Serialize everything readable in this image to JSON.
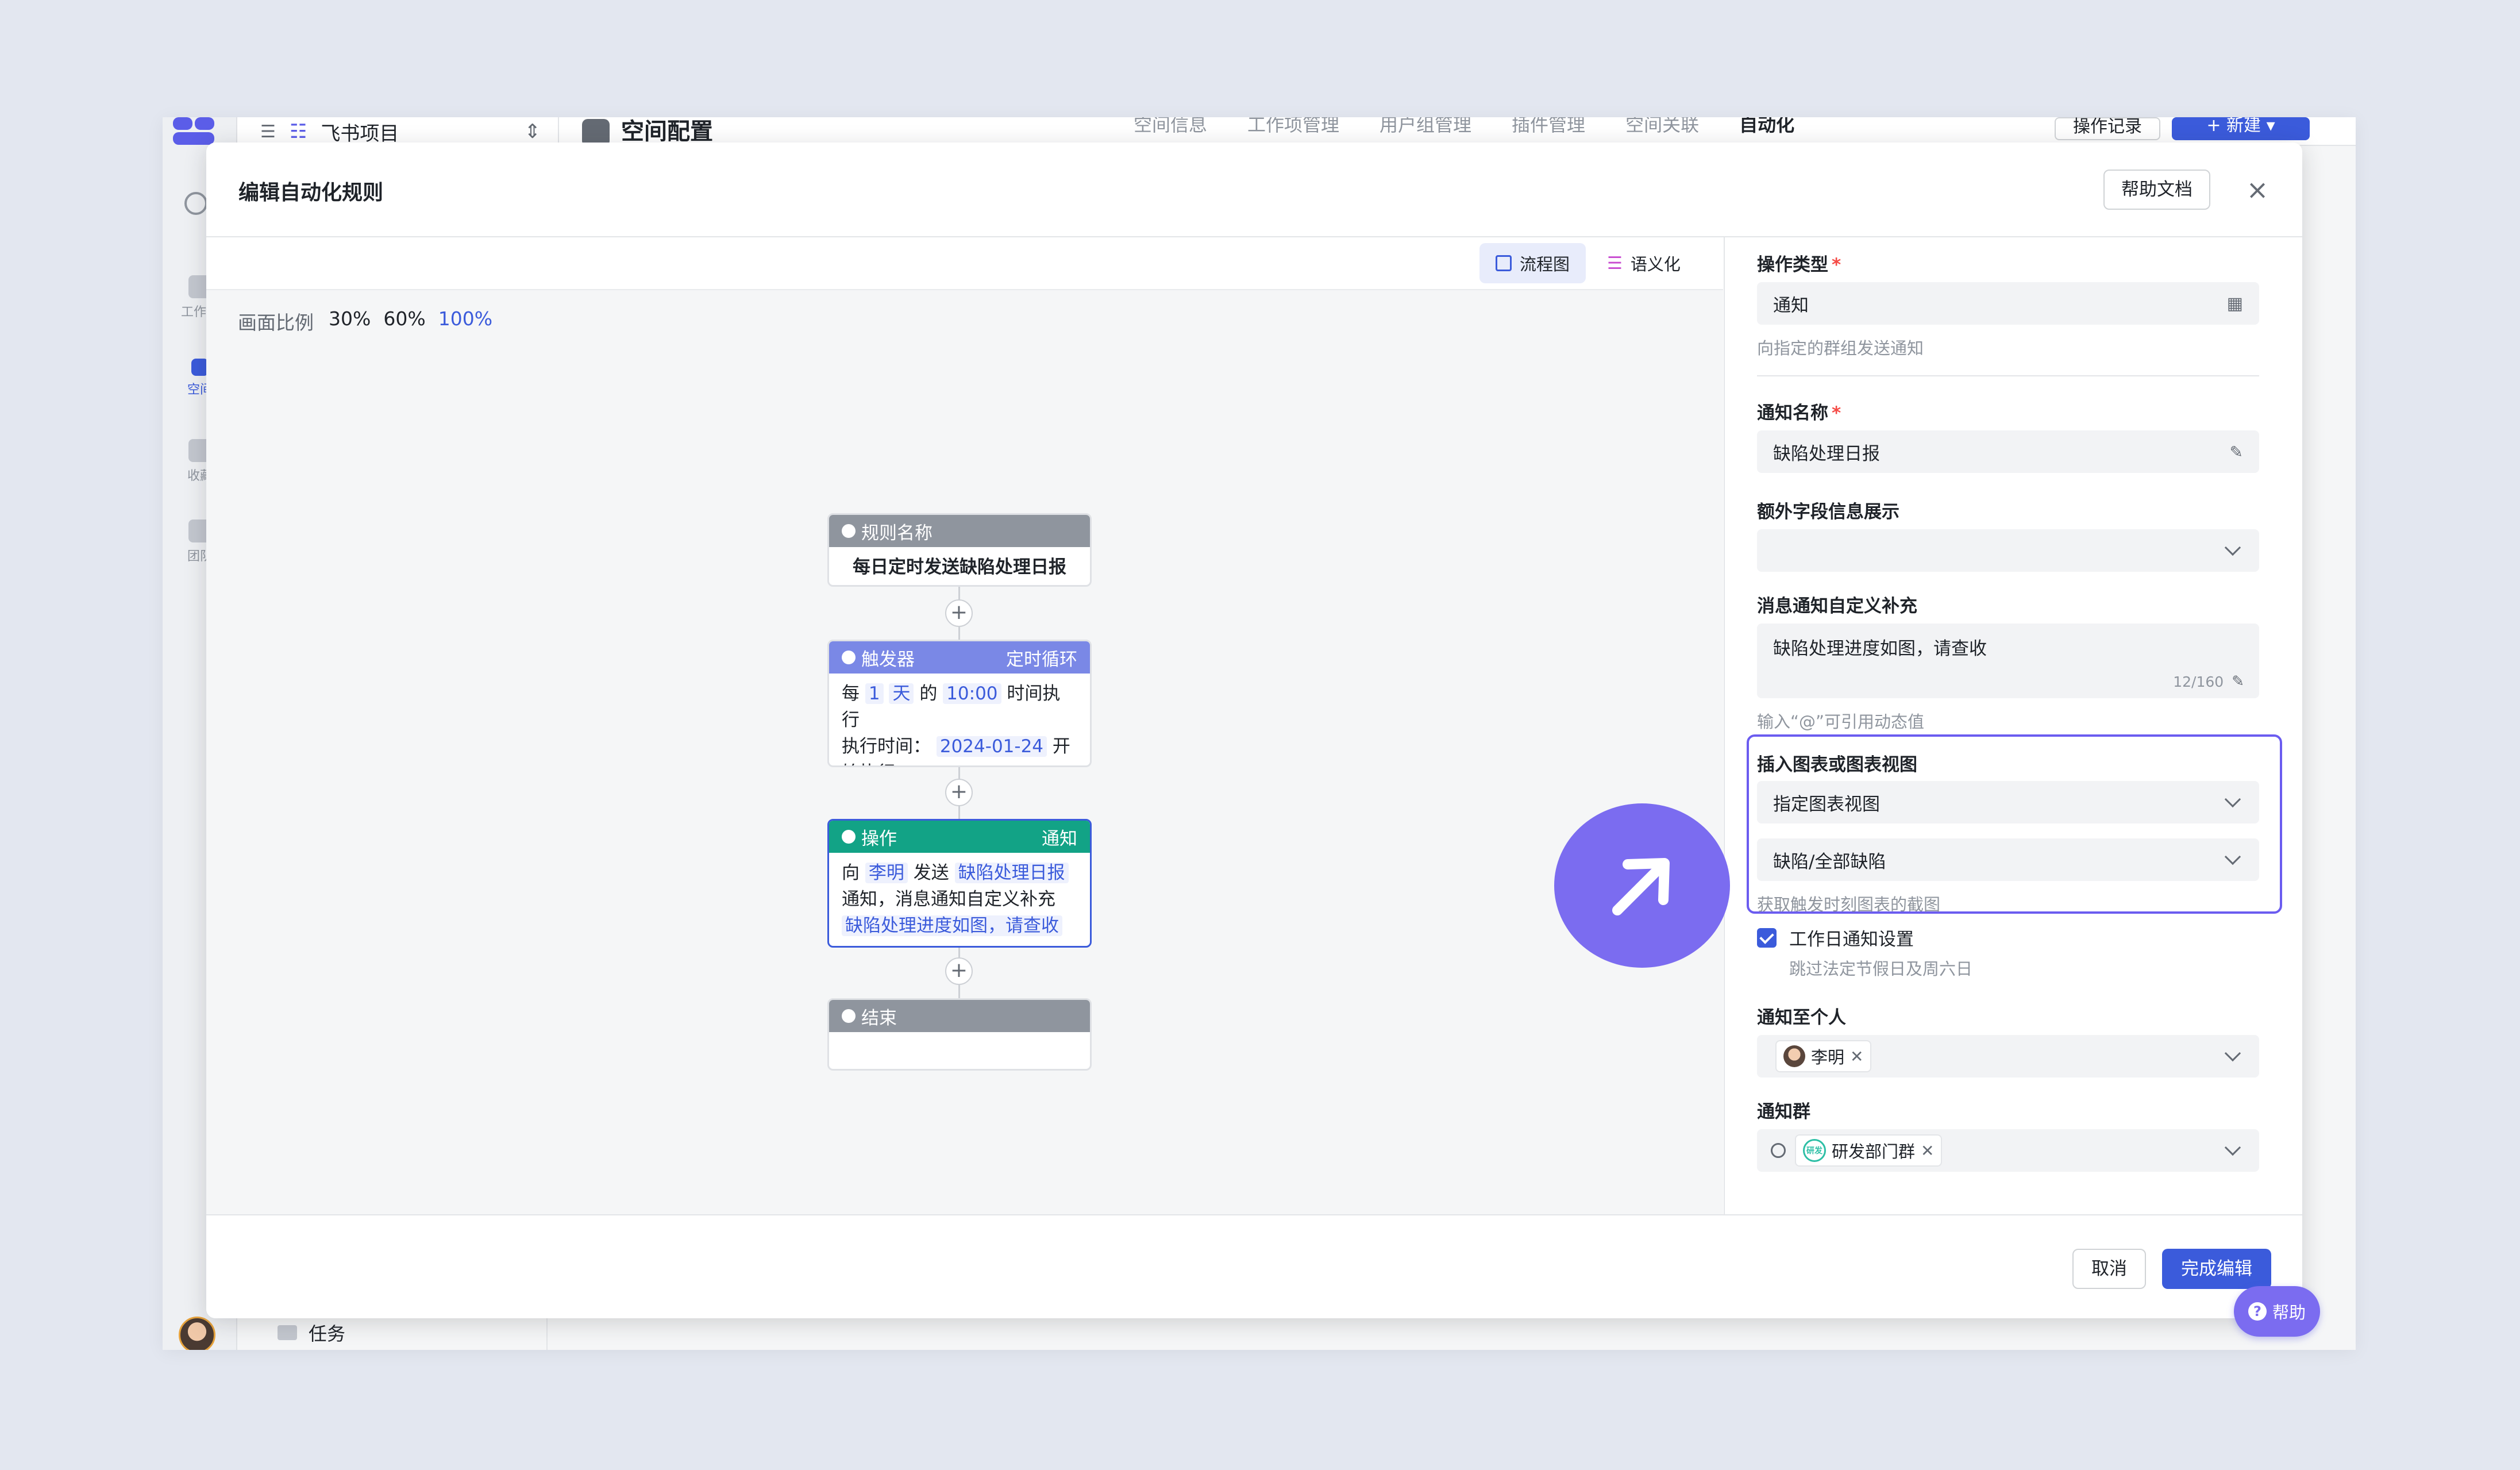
{
  "app": {
    "project_name": "飞书项目",
    "page_title": "空间配置",
    "tabs": [
      "空间信息",
      "工作项管理",
      "用户组管理",
      "插件管理",
      "空间关联",
      "自动化"
    ],
    "active_tab": "自动化",
    "log_button": "操作记录",
    "new_button": "新建",
    "nav": [
      "工作台",
      "空间",
      "收藏",
      "团队"
    ],
    "bottom_item": "任务"
  },
  "modal": {
    "title": "编辑自动化规则",
    "help_doc": "帮助文档",
    "close": "×"
  },
  "canvas": {
    "view_flow": "流程图",
    "view_semantic": "语义化",
    "zoom_label": "画面比例",
    "zoom_options": [
      "30%",
      "60%",
      "100%"
    ],
    "selected_zoom": "100%"
  },
  "nodes": {
    "rule": {
      "head": "规则名称",
      "body": "每日定时发送缺陷处理日报"
    },
    "trigger": {
      "head": "触发器",
      "tag": "定时循环",
      "p1": "每",
      "v1": "1",
      "v2": "天",
      "p2": "的",
      "v3": "10:00",
      "p3": "时间执行",
      "p4": "执行时间：",
      "v4": "2024-01-24",
      "p5": "开始执行"
    },
    "action": {
      "head": "操作",
      "tag": "通知",
      "p1": "向",
      "v1": "李明",
      "p2": "发送",
      "v2": "缺陷处理日报",
      "p3": "通知，消息通知自定义补充",
      "v3": "缺陷处理进度如图，请查收"
    },
    "end": {
      "head": "结束"
    }
  },
  "panel": {
    "action_type_label": "操作类型",
    "action_type_value": "通知",
    "action_type_hint": "向指定的群组发送通知",
    "notify_name_label": "通知名称",
    "notify_name_value": "缺陷处理日报",
    "extra_fields_label": "额外字段信息展示",
    "custom_msg_label": "消息通知自定义补充",
    "custom_msg_value": "缺陷处理进度如图，请查收",
    "custom_msg_counter": "12/160",
    "custom_msg_hint": "输入“@”可引用动态值",
    "chart_label": "插入图表或图表视图",
    "chart_select_1": "指定图表视图",
    "chart_select_2": "缺陷/全部缺陷",
    "chart_hint": "获取触发时刻图表的截图",
    "workday_label": "工作日通知设置",
    "workday_hint": "跳过法定节假日及周六日",
    "notify_person_label": "通知至个人",
    "notify_person_tag": "李明",
    "notify_group_label": "通知群",
    "notify_group_tag": "研发部门群",
    "group_icon_text": "研发"
  },
  "footer": {
    "cancel": "取消",
    "done": "完成编辑"
  },
  "help_float": "帮助",
  "colors": {
    "primary": "#3b5bdb",
    "rule_head": "#8f959e",
    "trigger_head": "#7a88e6",
    "action_head": "#12a386",
    "end_head": "#8f959e",
    "accent_circle": "#7b6cf0"
  }
}
